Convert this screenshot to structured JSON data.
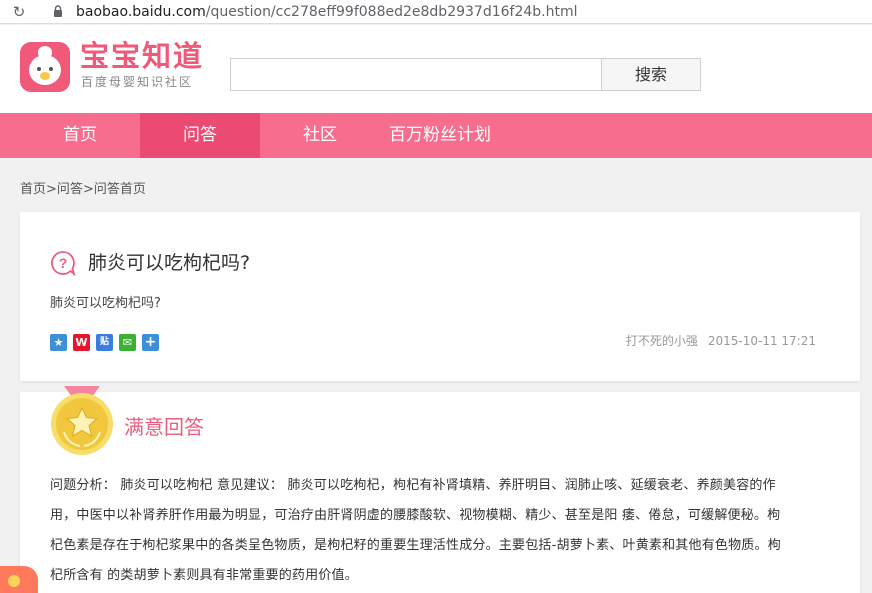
{
  "browser": {
    "url_host": "baobao.baidu.com",
    "url_path": "/question/cc278eff99f088ed2e8db2937d16f24b.html"
  },
  "site": {
    "logo_title": "宝宝知道",
    "logo_subtitle": "百度母婴知识社区",
    "search_value": "",
    "search_button": "搜索",
    "brand_color": "#f66d8d",
    "brand_active_color": "#eb4b73"
  },
  "nav": {
    "items": [
      {
        "label": "首页"
      },
      {
        "label": "问答"
      },
      {
        "label": "社区"
      },
      {
        "label": "百万粉丝计划"
      }
    ],
    "active": "问答"
  },
  "breadcrumb": {
    "items": [
      "首页",
      "问答",
      "问答首页"
    ],
    "separator": ">"
  },
  "question": {
    "title": "肺炎可以吃枸杞吗?",
    "description": "肺炎可以吃枸杞吗?",
    "share_icons": [
      "qzone-icon",
      "weibo-icon",
      "tieba-icon",
      "wechat-icon",
      "more-share-icon"
    ],
    "author": "打不死的小强",
    "datetime": "2015-10-11 17:21"
  },
  "answer": {
    "label": "满意回答",
    "lines": [
      "问题分析： 肺炎可以吃枸杞 意见建议： 肺炎可以吃枸杞，枸杞有补肾填精、养肝明目、润肺止咳、延缓衰老、养颜美容的作",
      "用，中医中以补肾养肝作用最为明显，可治疗由肝肾阴虚的腰膝酸软、视物模糊、精少、甚至是阳 痿、倦怠，可缓解便秘。枸",
      "杞色素是存在于枸杞浆果中的各类呈色物质，是枸杞籽的重要生理活性成分。主要包括-胡萝卜素、叶黄素和其他有色物质。枸",
      "杞所含有 的类胡萝卜素则具有非常重要的药用价值。"
    ]
  }
}
